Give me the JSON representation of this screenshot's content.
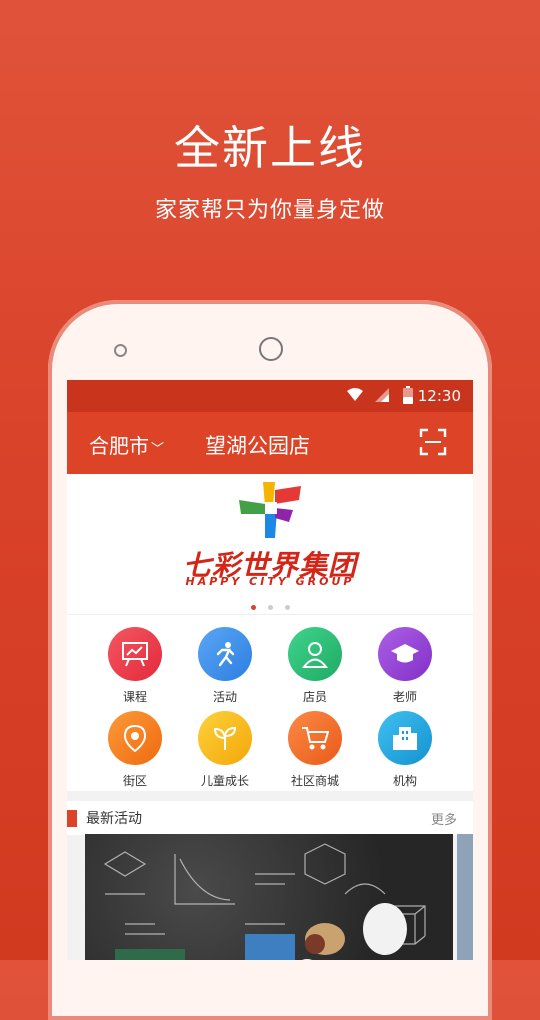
{
  "promo": {
    "headline": "全新上线",
    "subline": "家家帮只为你量身定做"
  },
  "status_bar": {
    "time": "12:30"
  },
  "app_bar": {
    "city": "合肥市",
    "store": "望湖公园店"
  },
  "banner": {
    "brand_cn": "七彩世界集团",
    "brand_en": "HAPPY CITY GROUP",
    "active_page": 1,
    "page_count": 3
  },
  "menu": [
    {
      "label": "课程",
      "icon": "presentation-board-icon",
      "color": "#ef3a4a"
    },
    {
      "label": "活动",
      "icon": "running-person-icon",
      "color": "#3a8ee8"
    },
    {
      "label": "店员",
      "icon": "person-icon",
      "color": "#2cc07a"
    },
    {
      "label": "老师",
      "icon": "graduation-cap-icon",
      "color": "#9b3fd6"
    },
    {
      "label": "街区",
      "icon": "map-pin-icon",
      "color": "#f57c14"
    },
    {
      "label": "儿童成长",
      "icon": "sprout-icon",
      "color": "#f6b514"
    },
    {
      "label": "社区商城",
      "icon": "shopping-cart-icon",
      "color": "#f06a28"
    },
    {
      "label": "机构",
      "icon": "building-icon",
      "color": "#24a8e0"
    }
  ],
  "latest": {
    "title": "最新活动",
    "more": "更多"
  }
}
